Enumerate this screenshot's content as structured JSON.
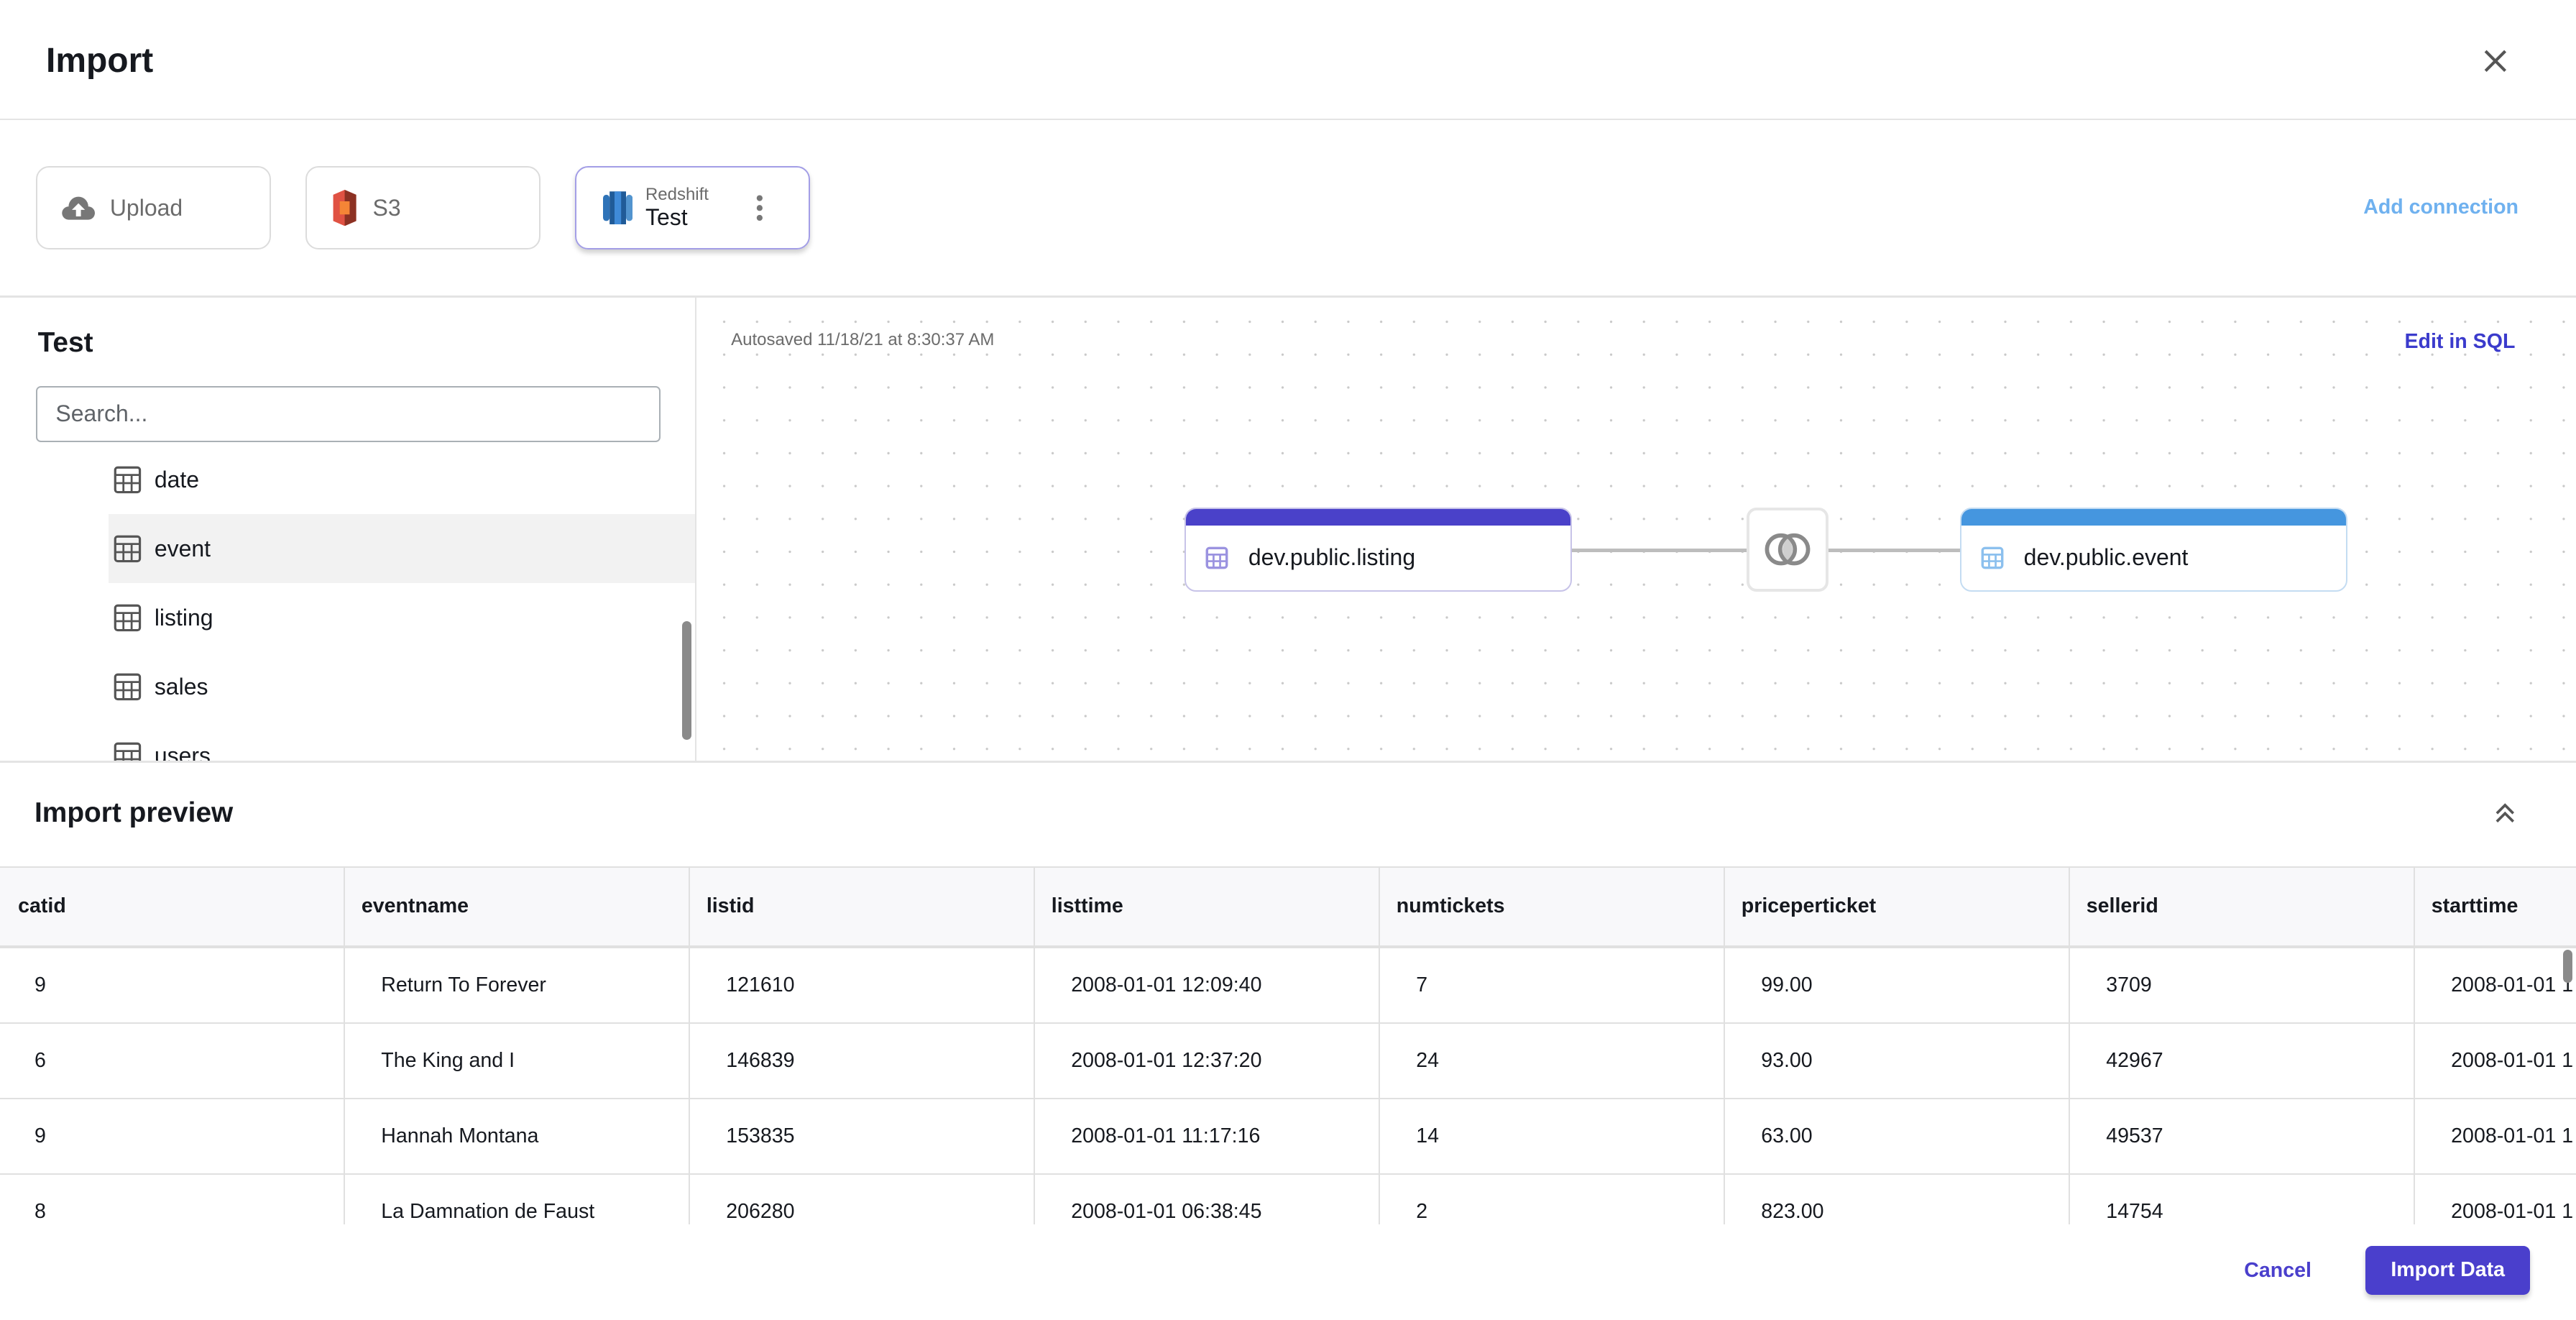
{
  "dialog": {
    "title": "Import",
    "close_icon": "close-icon"
  },
  "connections": {
    "items": [
      {
        "label": "Upload",
        "icon": "cloud-upload-icon"
      },
      {
        "label": "S3",
        "icon": "s3-icon"
      },
      {
        "type": "Redshift",
        "label": "Test",
        "icon": "redshift-icon",
        "selected": true
      }
    ],
    "add_label": "Add connection"
  },
  "browser": {
    "title": "Test",
    "search_placeholder": "Search...",
    "tables": [
      "date",
      "event",
      "listing",
      "sales",
      "users"
    ],
    "highlighted": "event"
  },
  "canvas": {
    "autosaved": "Autosaved 11/18/21 at 8:30:37 AM",
    "edit_sql": "Edit in SQL",
    "left_node": {
      "label": "dev.public.listing",
      "color": "#4a41c9"
    },
    "right_node": {
      "label": "dev.public.event",
      "color": "#4596df"
    },
    "join_icon": "inner-join-icon"
  },
  "preview": {
    "title": "Import preview",
    "columns": [
      "catid",
      "eventname",
      "listid",
      "listtime",
      "numtickets",
      "priceperticket",
      "sellerid",
      "starttime"
    ],
    "rows": [
      [
        "9",
        "Return To Forever",
        "121610",
        "2008-01-01 12:09:40",
        "7",
        "99.00",
        "3709",
        "2008-01-01 1"
      ],
      [
        "6",
        "The King and I",
        "146839",
        "2008-01-01 12:37:20",
        "24",
        "93.00",
        "42967",
        "2008-01-01 1"
      ],
      [
        "9",
        "Hannah Montana",
        "153835",
        "2008-01-01 11:17:16",
        "14",
        "63.00",
        "49537",
        "2008-01-01 1"
      ],
      [
        "8",
        "La Damnation de Faust",
        "206280",
        "2008-01-01 06:38:45",
        "2",
        "823.00",
        "14754",
        "2008-01-01 1"
      ]
    ]
  },
  "footer": {
    "cancel": "Cancel",
    "import": "Import Data"
  },
  "colors": {
    "accent": "#4a3fcc",
    "link": "#6fb1ef"
  }
}
